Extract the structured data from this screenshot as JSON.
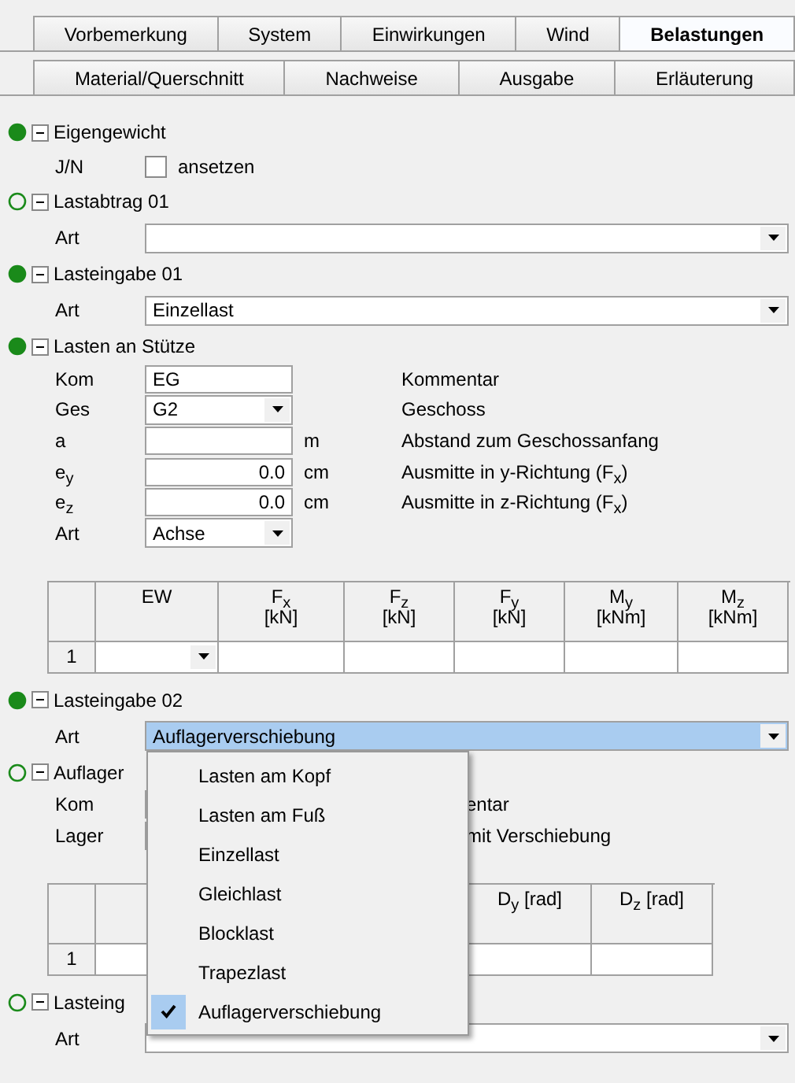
{
  "tabs_row_1": [
    {
      "label": "Vorbemerkung",
      "selected": false
    },
    {
      "label": "System",
      "selected": false
    },
    {
      "label": "Einwirkungen",
      "selected": false
    },
    {
      "label": "Wind",
      "selected": false
    },
    {
      "label": "Belastungen",
      "selected": true
    }
  ],
  "tabs_row_2": [
    {
      "label": "Material/Querschnitt",
      "selected": false
    },
    {
      "label": "Nachweise",
      "selected": false
    },
    {
      "label": "Ausgabe",
      "selected": false
    },
    {
      "label": "Erläuterung",
      "selected": false
    }
  ],
  "sections": [
    {
      "title": "Eigengewicht",
      "filled": true,
      "expanded": true,
      "covered": false,
      "fields": [
        {
          "kind": "checkbox",
          "label": "J/N",
          "text": "ansetzen",
          "checked": false
        }
      ]
    },
    {
      "title": "Lastabtrag 01",
      "filled": false,
      "expanded": true,
      "covered": false,
      "fields": [
        {
          "kind": "combo",
          "label": "Art",
          "focused": false
        }
      ]
    },
    {
      "title": "Lasteingabe 01",
      "filled": true,
      "expanded": true,
      "covered": false,
      "fields": [
        {
          "kind": "combo",
          "label": "Art",
          "value": "Einzellast",
          "focused": false
        }
      ]
    },
    {
      "title": "Lasten an Stütze",
      "filled": true,
      "expanded": true,
      "covered": false,
      "fields": [
        {
          "kind": "input",
          "label": "Kom",
          "value": "EG",
          "description": "Kommentar"
        },
        {
          "kind": "small-combo",
          "label": "Ges",
          "value": "G2",
          "description": "Geschoss"
        },
        {
          "kind": "input",
          "label": "a",
          "unit": "m",
          "description": "Abstand zum Geschossanfang"
        },
        {
          "kind": "input",
          "label": "e$_{y}$",
          "value": "0.0",
          "numeric": true,
          "unit": "cm",
          "description": "Ausmitte in y-Richtung (F$_{x}$)"
        },
        {
          "kind": "input",
          "label": "e$_{z}$",
          "value": "0.0",
          "numeric": true,
          "unit": "cm",
          "description": "Ausmitte in z-Richtung (F$_{x}$)"
        },
        {
          "kind": "small-combo",
          "label": "Art",
          "value": "Achse"
        },
        {
          "kind": "table",
          "columns": [
            {
              "label": "EW"
            },
            {
              "label": "F$_{x}$\n[kN]"
            },
            {
              "label": "F$_{z}$\n[kN]"
            },
            {
              "label": "F$_{y}$\n[kN]"
            },
            {
              "label": "M$_{y}$\n[kNm]"
            },
            {
              "label": "M$_{z}$\n[kNm]"
            }
          ],
          "rows": [
            {
              "number": "1"
            }
          ]
        }
      ]
    },
    {
      "title": "Lasteingabe 02",
      "filled": true,
      "expanded": true,
      "covered": false,
      "fields": [
        {
          "kind": "combo",
          "label": "Art",
          "value": "Auflagerverschiebung",
          "focused": true,
          "menu": [
            {
              "label": "Lasten am Kopf",
              "checked": false
            },
            {
              "label": "Lasten am Fuß",
              "checked": false
            },
            {
              "label": "Einzellast",
              "checked": false
            },
            {
              "label": "Gleichlast",
              "checked": false
            },
            {
              "label": "Blocklast",
              "checked": false
            },
            {
              "label": "Trapezlast",
              "checked": false
            },
            {
              "label": "Auflagerverschiebung",
              "checked": true
            }
          ]
        }
      ]
    },
    {
      "title": "Auflager",
      "filled": false,
      "expanded": true,
      "covered": true,
      "fields": [
        {
          "kind": "input",
          "label": "Kom",
          "description": "entar"
        },
        {
          "kind": "input",
          "label": "Lager",
          "description": "mit Verschiebung"
        },
        {
          "kind": "table",
          "columns": [
            {
              "label": "D$_{y}$ [rad]"
            },
            {
              "label": "D$_{z}$ [rad]"
            }
          ],
          "rows": [
            {
              "number": "1"
            }
          ]
        }
      ]
    },
    {
      "title": "Lasteing",
      "filled": false,
      "expanded": true,
      "covered": true,
      "fields": [
        {
          "kind": "combo",
          "label": "Art",
          "focused": false
        }
      ]
    }
  ]
}
